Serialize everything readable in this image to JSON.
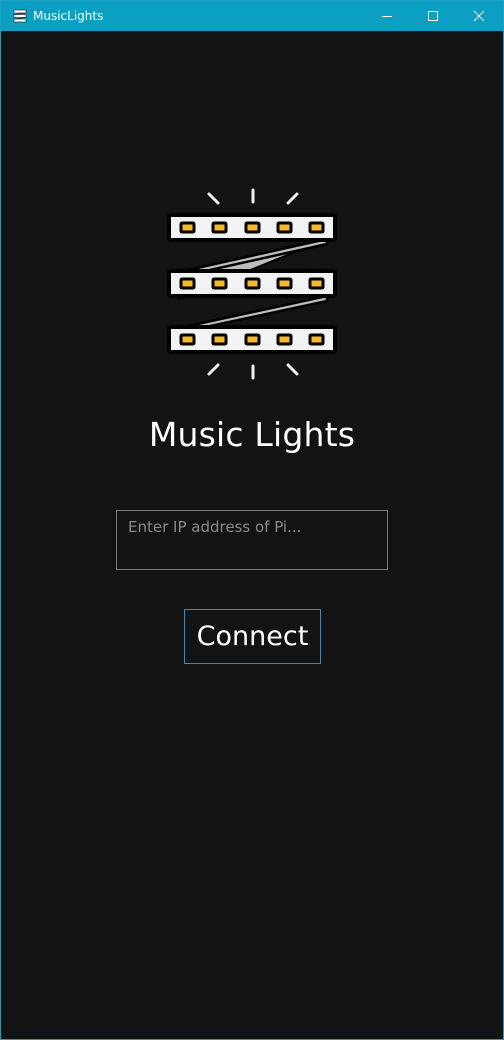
{
  "window": {
    "title": "MusicLights",
    "accent_color": "#0c9fc4",
    "background_color": "#131313"
  },
  "logo": {
    "icon": "led-strip-icon",
    "strip_color": "#f2f2f2",
    "led_color": "#f5b82e"
  },
  "main": {
    "app_title": "Music Lights",
    "ip_input": {
      "value": "",
      "placeholder": "Enter IP address of Pi..."
    },
    "connect_label": "Connect",
    "connect_border_color": "#2b8fd6"
  }
}
